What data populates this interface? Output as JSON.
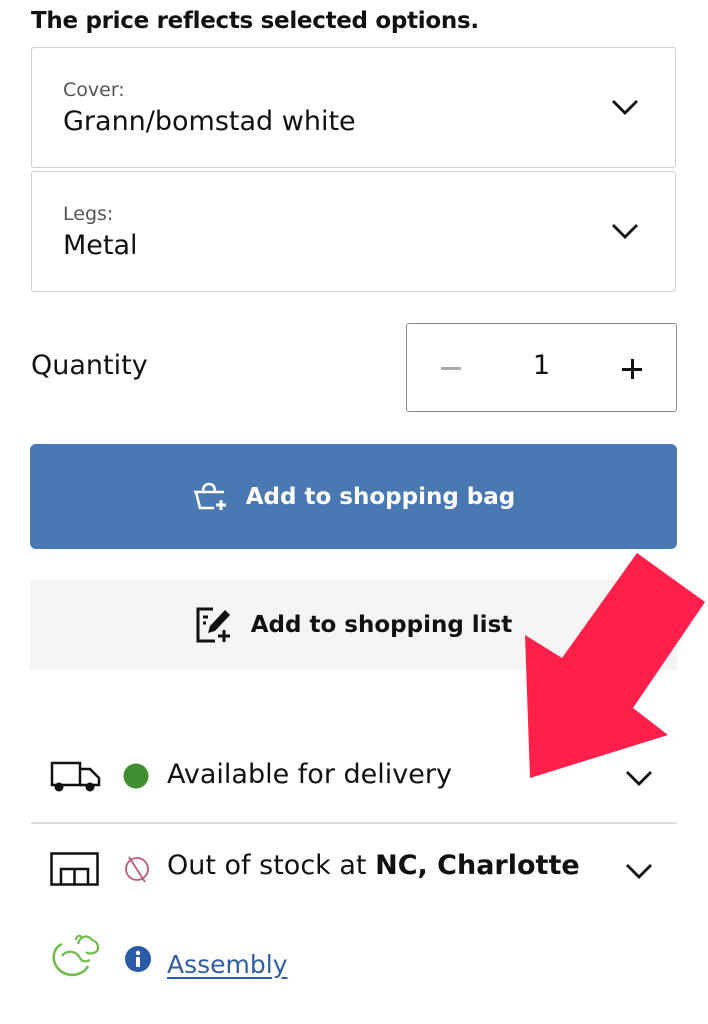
{
  "price_note": "The price reflects selected options.",
  "options": [
    {
      "label": "Cover:",
      "value": "Grann/bomstad white",
      "icon": "chevron-down-icon"
    },
    {
      "label": "Legs:",
      "value": "Metal",
      "icon": "chevron-down-icon"
    }
  ],
  "quantity": {
    "label": "Quantity",
    "value": "1",
    "decrement_icon": "minus-icon",
    "increment_icon": "plus-icon"
  },
  "buttons": {
    "add_to_bag": {
      "label": "Add to shopping bag",
      "icon": "basket-plus-icon"
    },
    "add_to_list": {
      "label": "Add to shopping list",
      "icon": "list-edit-plus-icon"
    }
  },
  "availability": {
    "delivery": {
      "icon": "truck-icon",
      "status_icon": "green-dot-icon",
      "text": "Available for delivery"
    },
    "store": {
      "icon": "store-icon",
      "status_icon": "out-of-stock-icon",
      "text_prefix": "Out of stock at ",
      "store_name": "NC, Charlotte"
    }
  },
  "assembly": {
    "icon": "taskrabbit-icon",
    "info_icon": "info-icon",
    "link_label": "Assembly"
  },
  "annotation": {
    "icon": "red-arrow-icon"
  },
  "colors": {
    "primary_button": "#4a78b2",
    "secondary_button": "#f4f4f4",
    "available": "#3e8e2f",
    "out_of_stock": "#c4567a",
    "link": "#2f5ea6",
    "info": "#2a5aa8",
    "taskrabbit": "#6cbd45",
    "annotation_arrow": "#ff1f4b"
  }
}
